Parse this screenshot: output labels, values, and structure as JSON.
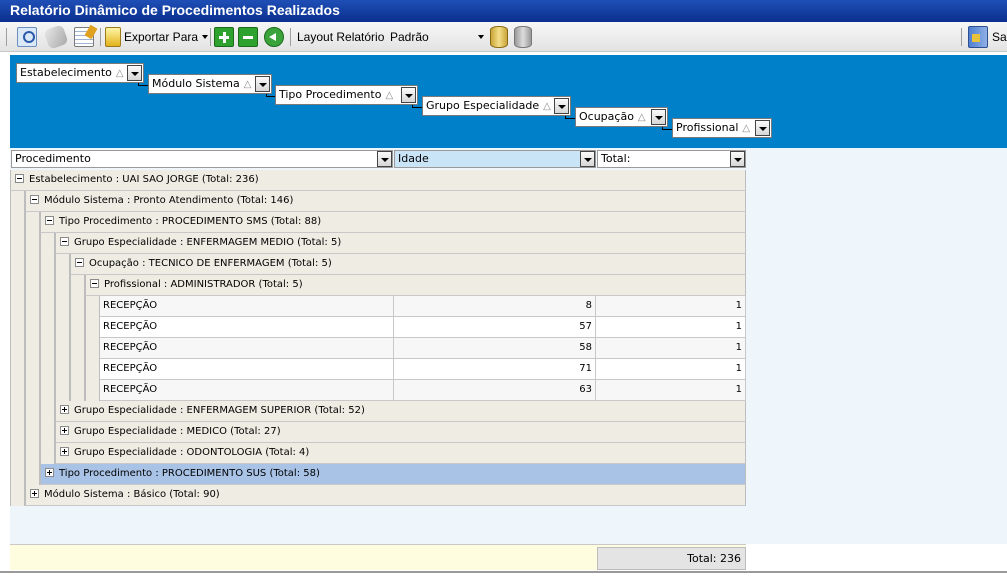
{
  "window": {
    "title": "Relatório Dinâmico de Procedimentos Realizados"
  },
  "toolbar": {
    "export_label": "Exportar Para",
    "layout_label": "Layout Relatório",
    "layout_value": "Padrão",
    "exit_label": "Sa",
    "icons": [
      "search-icon",
      "eraser-icon",
      "grid-edit-icon",
      "export-icon",
      "expand-all-icon",
      "collapse-all-icon",
      "back-icon",
      "save-layout-icon",
      "delete-layout-icon",
      "exit-icon"
    ]
  },
  "group_fields": [
    {
      "label": "Estabelecimento",
      "sort": "△"
    },
    {
      "label": "Módulo Sistema",
      "sort": "△"
    },
    {
      "label": "Tipo Procedimento",
      "sort": "△"
    },
    {
      "label": "Grupo Especialidade",
      "sort": "△"
    },
    {
      "label": "Ocupação",
      "sort": "△"
    },
    {
      "label": "Profissional",
      "sort": "△"
    }
  ],
  "columns": [
    {
      "label": "Procedimento"
    },
    {
      "label": "Idade"
    },
    {
      "label": "Total:"
    }
  ],
  "groups": {
    "g1": "Estabelecimento : UAI SAO JORGE (Total: 236)",
    "g2": "Módulo Sistema :  Pronto Atendimento (Total: 146)",
    "g3": "Tipo Procedimento : PROCEDIMENTO SMS (Total: 88)",
    "g4": "Grupo Especialidade : ENFERMAGEM MEDIO (Total: 5)",
    "g5": "Ocupação : TECNICO DE ENFERMAGEM (Total: 5)",
    "g6": "Profissional : ADMINISTRADOR (Total: 5)",
    "g7": "Grupo Especialidade : ENFERMAGEM SUPERIOR (Total: 52)",
    "g8": "Grupo Especialidade : MEDICO (Total: 27)",
    "g9": "Grupo Especialidade : ODONTOLOGIA (Total: 4)",
    "g10": "Tipo Procedimento : PROCEDIMENTO SUS (Total: 58)",
    "g11": "Módulo Sistema : Básico (Total: 90)"
  },
  "rows": [
    {
      "procedimento": "RECEPÇÃO",
      "idade": "8",
      "total": "1"
    },
    {
      "procedimento": "RECEPÇÃO",
      "idade": "57",
      "total": "1"
    },
    {
      "procedimento": "RECEPÇÃO",
      "idade": "58",
      "total": "1"
    },
    {
      "procedimento": "RECEPÇÃO",
      "idade": "71",
      "total": "1"
    },
    {
      "procedimento": "RECEPÇÃO",
      "idade": "63",
      "total": "1"
    }
  ],
  "footer": {
    "total": "Total: 236"
  },
  "colors": {
    "title_bar": "#0a2f8e",
    "group_area": "#0080c8",
    "group_row": "#efede3",
    "highlight_row": "#a9c3e6",
    "footer": "#fffde0"
  }
}
